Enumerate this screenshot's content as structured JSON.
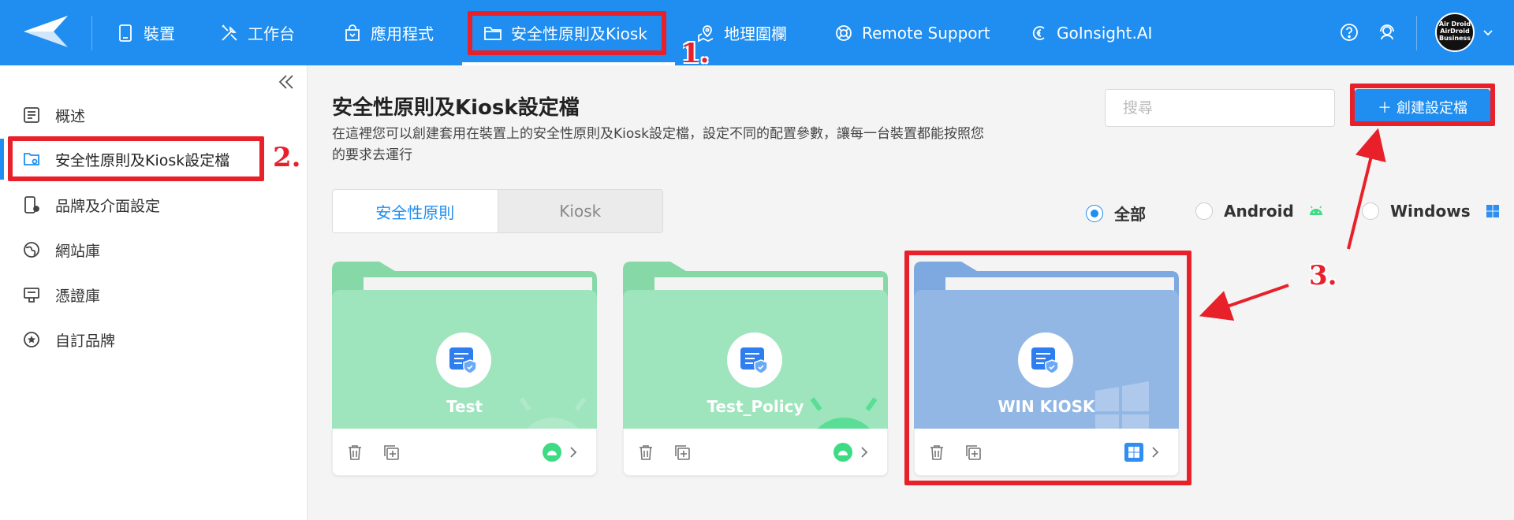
{
  "colors": {
    "brand": "#1f8ef0",
    "annotation": "#e8202a",
    "android_card": "#9ee4bc",
    "windows_card": "#93b7e5"
  },
  "nav": {
    "items": [
      {
        "label": "裝置",
        "icon": "tablet-icon"
      },
      {
        "label": "工作台",
        "icon": "tools-icon"
      },
      {
        "label": "應用程式",
        "icon": "shopping-bag-icon"
      },
      {
        "label": "安全性原則及Kiosk",
        "icon": "folder-icon"
      },
      {
        "label": "地理圍欄",
        "icon": "map-pin-icon"
      },
      {
        "label": "Remote Support",
        "icon": "lifebuoy-icon"
      },
      {
        "label": "GoInsight.AI",
        "icon": "goinsight-icon"
      }
    ],
    "avatar_text": "Air Droid AirDroid Business"
  },
  "sidebar": {
    "items": [
      {
        "label": "概述",
        "icon": "list-doc-icon"
      },
      {
        "label": "安全性原則及Kiosk設定檔",
        "icon": "folder-gear-icon"
      },
      {
        "label": "品牌及介面設定",
        "icon": "phone-settings-icon"
      },
      {
        "label": "網站庫",
        "icon": "globe-icon"
      },
      {
        "label": "憑證庫",
        "icon": "certificate-icon"
      },
      {
        "label": "自訂品牌",
        "icon": "star-circle-icon"
      }
    ]
  },
  "main": {
    "title": "安全性原則及Kiosk設定檔",
    "description": "在這裡您可以創建套用在裝置上的安全性原則及Kiosk設定檔，設定不同的配置參數，讓每一台裝置都能按照您的要求去運行",
    "search_placeholder": "搜尋",
    "create_label": "創建設定檔",
    "tabs": [
      "安全性原則",
      "Kiosk"
    ],
    "filters": [
      {
        "label": "全部",
        "selected": true
      },
      {
        "label": "Android",
        "selected": false
      },
      {
        "label": "Windows",
        "selected": false
      }
    ],
    "cards": [
      {
        "name": "Test",
        "os": "android"
      },
      {
        "name": "Test_Policy",
        "os": "android"
      },
      {
        "name": "WIN KIOSK",
        "os": "windows"
      }
    ]
  },
  "annotations": {
    "step1": "1.",
    "step2": "2.",
    "step3": "3."
  }
}
